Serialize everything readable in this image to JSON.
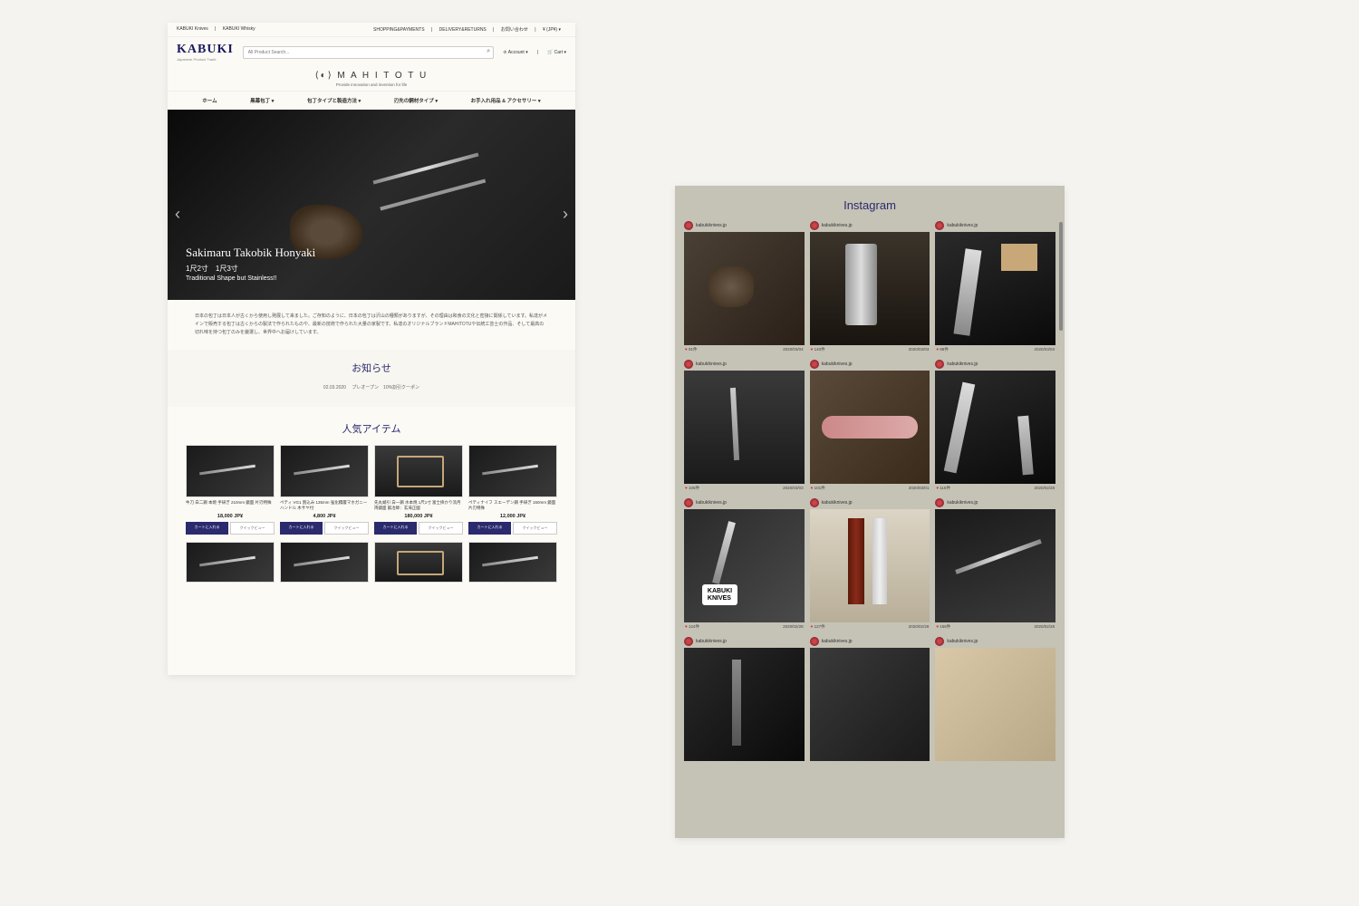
{
  "topbar": {
    "left": [
      "KABUKI Knives",
      "|",
      "KABUKI Whisky"
    ],
    "right": [
      "SHOPPING&PAYMENTS",
      "|",
      "DELIVERY&RETURNS",
      "|",
      "お問い合わせ",
      "|",
      "¥ (JP¥) ▾"
    ]
  },
  "logo": {
    "main": "KABUKI",
    "sub": "Japanese Product Trade"
  },
  "search": {
    "placeholder": "All Product Search..."
  },
  "header_links": {
    "account": "♔ Account ▾",
    "cart": "🛒 Cart ▾"
  },
  "brand": {
    "logo": "⟨◐⟩ M A H I T O T U",
    "tagline": "Provide innovation and invention for life"
  },
  "nav": [
    "ホーム",
    "黒幕包丁 ▾",
    "包丁タイプと製造方法 ▾",
    "刃先の鋼材タイプ ▾",
    "お手入れ用品 & アクセサリー ▾"
  ],
  "hero": {
    "title": "Sakimaru Takobik Honyaki",
    "sub1": "1尺2寸　1尺3寸",
    "sub2": "Traditional Shape but Stainless!!"
  },
  "intro": "日本の包丁は日本人が古くから使用し発展して来ました。ご存知のように、日本の包丁は沢山の種類がありますが、その理由は和食の文化と密接に関係しています。私達がメインで販売する包丁は古くからの製法で作られたものや、最新の技術で作られた大量の家製です。私達のオリジナルブランドMAHITOTUや伝統工芸士の作品、そして最高の切れ味を持つ包丁のみを厳選し、世界中へお届けしています。",
  "news": {
    "title": "お知らせ",
    "items": [
      {
        "date": "02.03.2020",
        "text": "プレオープン　10%割引クーポン"
      }
    ]
  },
  "popular": {
    "title": "人気アイテム",
    "products": [
      {
        "name": "牛刀 白二鋼 本焼 手研ぎ 210mm 鏡面 片刃特殊",
        "price": "18,000 JP¥"
      },
      {
        "name": "ペティ VG1 割込み 135mm 強化積層マホガニーハンドル 木サヤ付",
        "price": "4,800 JP¥"
      },
      {
        "name": "先丸蛸引 白一鋼 水本焼 1尺1寸 富士掛かり流月 両鏡面 鍛冶師：玄海正國",
        "price": "180,000 JP¥"
      },
      {
        "name": "ペティナイフ スエーデン鋼 手研ぎ 150mm 鏡面 片刃特殊",
        "price": "12,000 JP¥"
      }
    ],
    "cart_label": "カートに入れる",
    "quick_label": "クイックビュー"
  },
  "instagram": {
    "title": "Instagram",
    "username": "kabukiknives.jp",
    "posts": [
      {
        "likes": "91件",
        "date": "2020/03/04",
        "v": "v1"
      },
      {
        "likes": "140件",
        "date": "2020/03/03",
        "v": "v2"
      },
      {
        "likes": "98件",
        "date": "2020/03/03",
        "v": "v3"
      },
      {
        "likes": "105件",
        "date": "2020/03/03",
        "v": "v4"
      },
      {
        "likes": "101件",
        "date": "2020/03/01",
        "v": "v5"
      },
      {
        "likes": "115件",
        "date": "2020/02/28",
        "v": "v6"
      },
      {
        "likes": "124件",
        "date": "2020/02/28",
        "v": "v7"
      },
      {
        "likes": "127件",
        "date": "2020/02/28",
        "v": "v8"
      },
      {
        "likes": "156件",
        "date": "2020/02/28",
        "v": "v9"
      },
      {
        "likes": "",
        "date": "",
        "v": "v10"
      },
      {
        "likes": "",
        "date": "",
        "v": "v11"
      },
      {
        "likes": "",
        "date": "",
        "v": "v12"
      }
    ]
  }
}
